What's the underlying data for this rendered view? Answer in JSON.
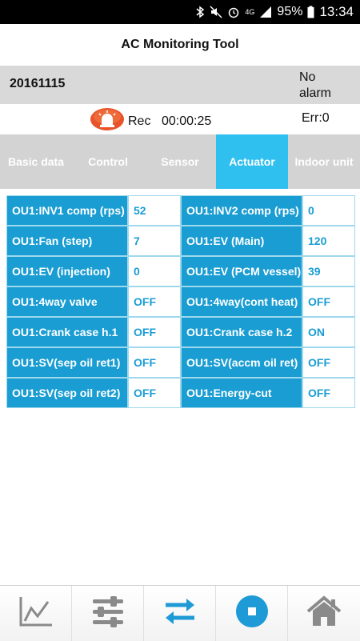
{
  "status_bar": {
    "battery": "95%",
    "time": "13:34",
    "network": "4G"
  },
  "app": {
    "title": "AC Monitoring Tool"
  },
  "info": {
    "date": "20161115",
    "alarm_line1": "No",
    "alarm_line2": "alarm",
    "rec_label": "Rec",
    "rec_time": "00:00:25",
    "err": "Err:0"
  },
  "tabs": [
    {
      "label": "Basic data",
      "active": false
    },
    {
      "label": "Control",
      "active": false
    },
    {
      "label": "Sensor",
      "active": false
    },
    {
      "label": "Actuator",
      "active": true
    },
    {
      "label": "Indoor unit",
      "active": false
    }
  ],
  "rows": [
    {
      "l1": "OU1:INV1 comp (rps)",
      "v1": "52",
      "l2": "OU1:INV2 comp (rps)",
      "v2": "0"
    },
    {
      "l1": "OU1:Fan (step)",
      "v1": "7",
      "l2": "OU1:EV (Main)",
      "v2": "120"
    },
    {
      "l1": "OU1:EV (injection)",
      "v1": "0",
      "l2": "OU1:EV (PCM vessel)",
      "v2": "39"
    },
    {
      "l1": "OU1:4way valve",
      "v1": "OFF",
      "l2": "OU1:4way(cont heat)",
      "v2": "OFF"
    },
    {
      "l1": "OU1:Crank case h.1",
      "v1": "OFF",
      "l2": "OU1:Crank case h.2",
      "v2": "ON"
    },
    {
      "l1": "OU1:SV(sep oil ret1)",
      "v1": "OFF",
      "l2": "OU1:SV(accm oil ret)",
      "v2": "OFF"
    },
    {
      "l1": "OU1:SV(sep oil ret2)",
      "v1": "OFF",
      "l2": "OU1:Energy-cut",
      "v2": "OFF"
    }
  ],
  "bottom_nav": [
    {
      "icon": "graph-icon"
    },
    {
      "icon": "sliders-icon"
    },
    {
      "icon": "swap-arrows-icon"
    },
    {
      "icon": "stop-icon"
    },
    {
      "icon": "home-icon"
    }
  ],
  "colors": {
    "accent": "#2fc0f0",
    "cell_blue": "#1a9dd3",
    "tab_bg": "#d3d3d3",
    "stop_blue": "#1e9ad6"
  }
}
